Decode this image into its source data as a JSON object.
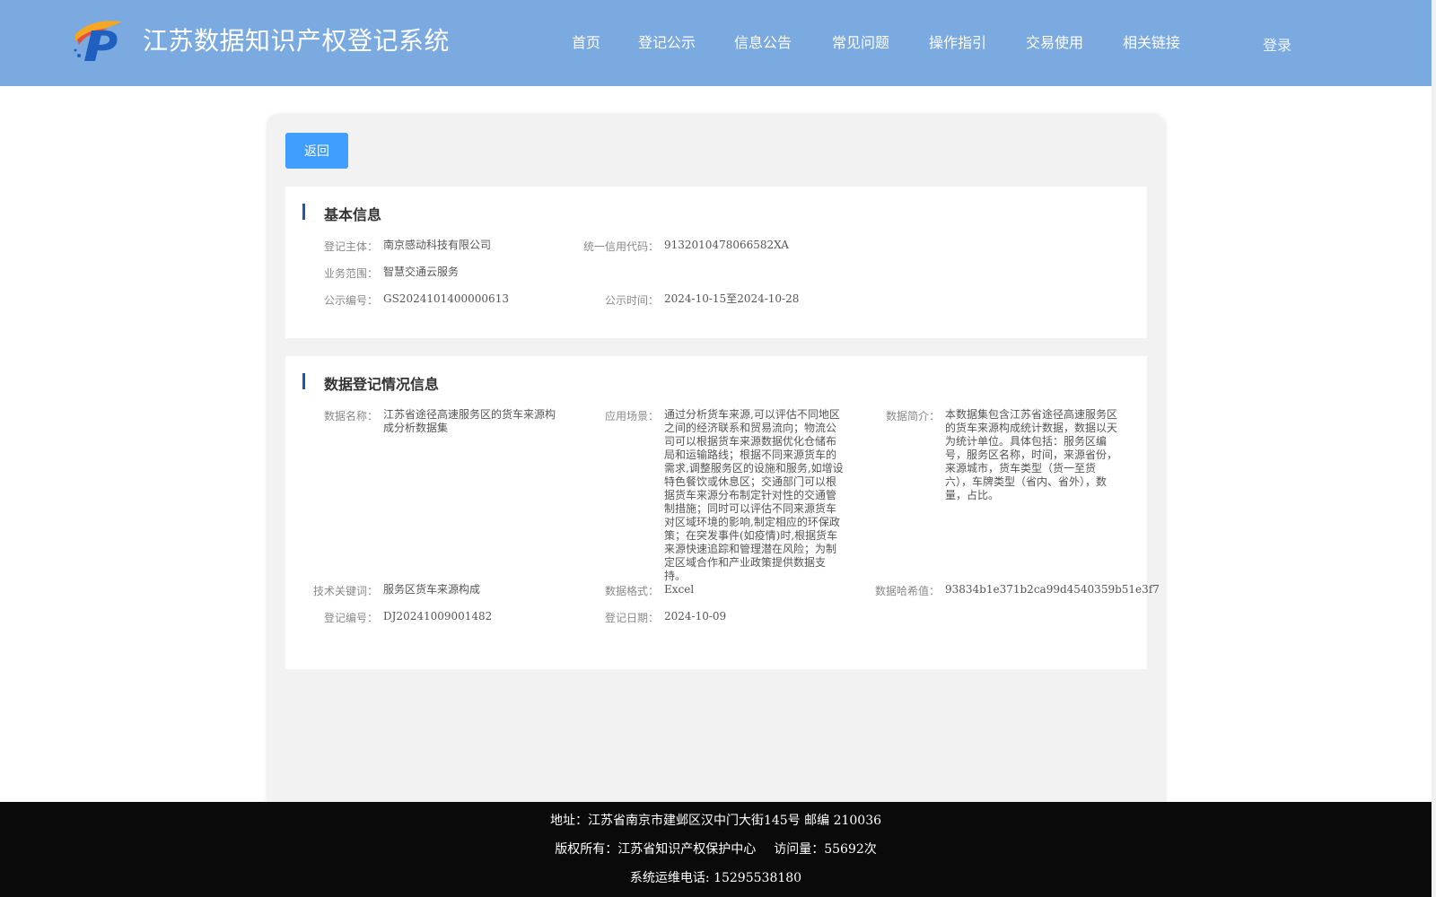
{
  "header": {
    "site_title": "江苏数据知识产权登记系统",
    "nav": [
      {
        "label": "首页"
      },
      {
        "label": "登记公示"
      },
      {
        "label": "信息公告"
      },
      {
        "label": "常见问题"
      },
      {
        "label": "操作指引"
      },
      {
        "label": "交易使用"
      },
      {
        "label": "相关链接"
      }
    ],
    "login_label": "登录",
    "brand_color": "#7aaae0"
  },
  "back_label": "返回",
  "basic": {
    "title": "基本信息",
    "entity_label": "登记主体：",
    "entity": "南京感动科技有限公司",
    "credit_code_label": "统一信用代码：",
    "credit_code": "9132010478066582XA",
    "scope_label": "业务范围：",
    "scope": "智慧交通云服务",
    "pub_no_label": "公示编号：",
    "pub_no": "GS2024101400000613",
    "pub_time_label": "公示时间：",
    "pub_time": "2024-10-15至2024-10-28"
  },
  "registration": {
    "title": "数据登记情况信息",
    "name_label": "数据名称：",
    "name": "江苏省途径高速服务区的货车来源构成分析数据集",
    "scenario_label": "应用场景：",
    "scenario": "通过分析货车来源,可以评估不同地区之间的经济联系和贸易流向；物流公司可以根据货车来源数据优化仓储布局和运输路线；根据不同来源货车的需求,调整服务区的设施和服务,如增设特色餐饮或休息区；交通部门可以根据货车来源分布制定针对性的交通管制措施；同时可以评估不同来源货车对区域环境的影响,制定相应的环保政策；在突发事件(如疫情)时,根据货车来源快速追踪和管理潜在风险；为制定区域合作和产业政策提供数据支持。",
    "intro_label": "数据简介：",
    "intro": "本数据集包含江苏省途径高速服务区的货车来源构成统计数据，数据以天为统计单位。具体包括：服务区编号，服务区名称，时间，来源省份，来源城市，货车类型（货一至货六），车牌类型（省内、省外），数量，占比。",
    "keywords_label": "技术关键词：",
    "keywords": "服务区货车来源构成",
    "format_label": "数据格式：",
    "format": "Excel",
    "hash_label": "数据哈希值：",
    "hash": "93834b1e371b2ca99d4540359b51e3f7",
    "reg_no_label": "登记编号：",
    "reg_no": "DJ20241009001482",
    "reg_date_label": "登记日期：",
    "reg_date": "2024-10-09"
  },
  "footer": {
    "address": "地址：江苏省南京市建邺区汉中门大街145号 邮编 210036",
    "copyright": "版权所有：江苏省知识产权保护中心",
    "visits": "访问量：55692次",
    "phone": "系统运维电话: 15295538180"
  }
}
